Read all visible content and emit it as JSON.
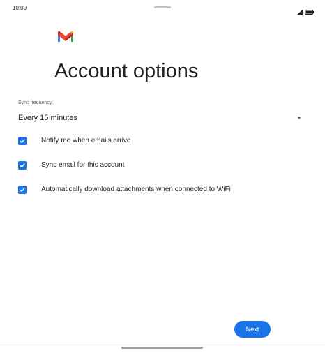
{
  "status_bar": {
    "time": "10:00",
    "icons": [
      "signal-icon",
      "battery-icon"
    ]
  },
  "logo": {
    "icon": "gmail-logo-icon"
  },
  "title": "Account options",
  "sync": {
    "label": "Sync frequency:",
    "selected_value": "Every 15 minutes",
    "icon": "dropdown-arrow-icon"
  },
  "options": [
    {
      "label": "Notify me when emails arrive",
      "checked": true
    },
    {
      "label": "Sync email for this account",
      "checked": true
    },
    {
      "label": "Automatically download attachments when connected to WiFi",
      "checked": true
    }
  ],
  "footer": {
    "next_label": "Next"
  },
  "colors": {
    "accent": "#1a73e8",
    "text": "#202124",
    "muted": "#5f6368"
  }
}
